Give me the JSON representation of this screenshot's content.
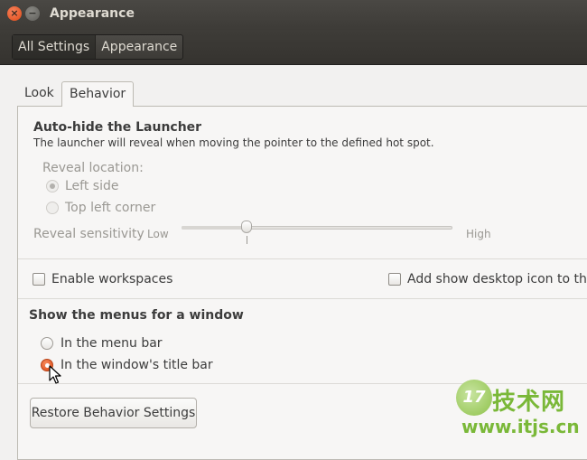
{
  "window": {
    "title": "Appearance",
    "close_glyph": "×",
    "minimize_glyph": "−"
  },
  "breadcrumbs": [
    "All Settings",
    "Appearance"
  ],
  "tabs": {
    "look": "Look",
    "behavior": "Behavior"
  },
  "launcher": {
    "heading": "Auto-hide the Launcher",
    "description": "The launcher will reveal when moving the pointer to the defined hot spot.",
    "reveal_location_label": "Reveal location:",
    "options": [
      "Left side",
      "Top left corner"
    ],
    "selected_option": "Left side",
    "sensitivity_label": "Reveal sensitivity",
    "sensitivity_low": "Low",
    "sensitivity_high": "High",
    "sensitivity_value": 0.24,
    "enabled": false
  },
  "workspaces": {
    "label": "Enable workspaces",
    "checked": false
  },
  "desktop_icon": {
    "label": "Add show desktop icon to the",
    "checked": false
  },
  "menus": {
    "heading": "Show the menus for a window",
    "options": [
      "In the menu bar",
      "In the window's title bar"
    ],
    "selected_option": "In the window's title bar"
  },
  "restore_button": "Restore Behavior Settings",
  "watermark": {
    "logo_text": "17",
    "text": "技术网",
    "url": "www.itjs.cn"
  },
  "colors": {
    "accent": "#dd4814",
    "titlebar": "#3e3c38",
    "panel": "#f7f6f5",
    "watermark": "#7ab838"
  }
}
